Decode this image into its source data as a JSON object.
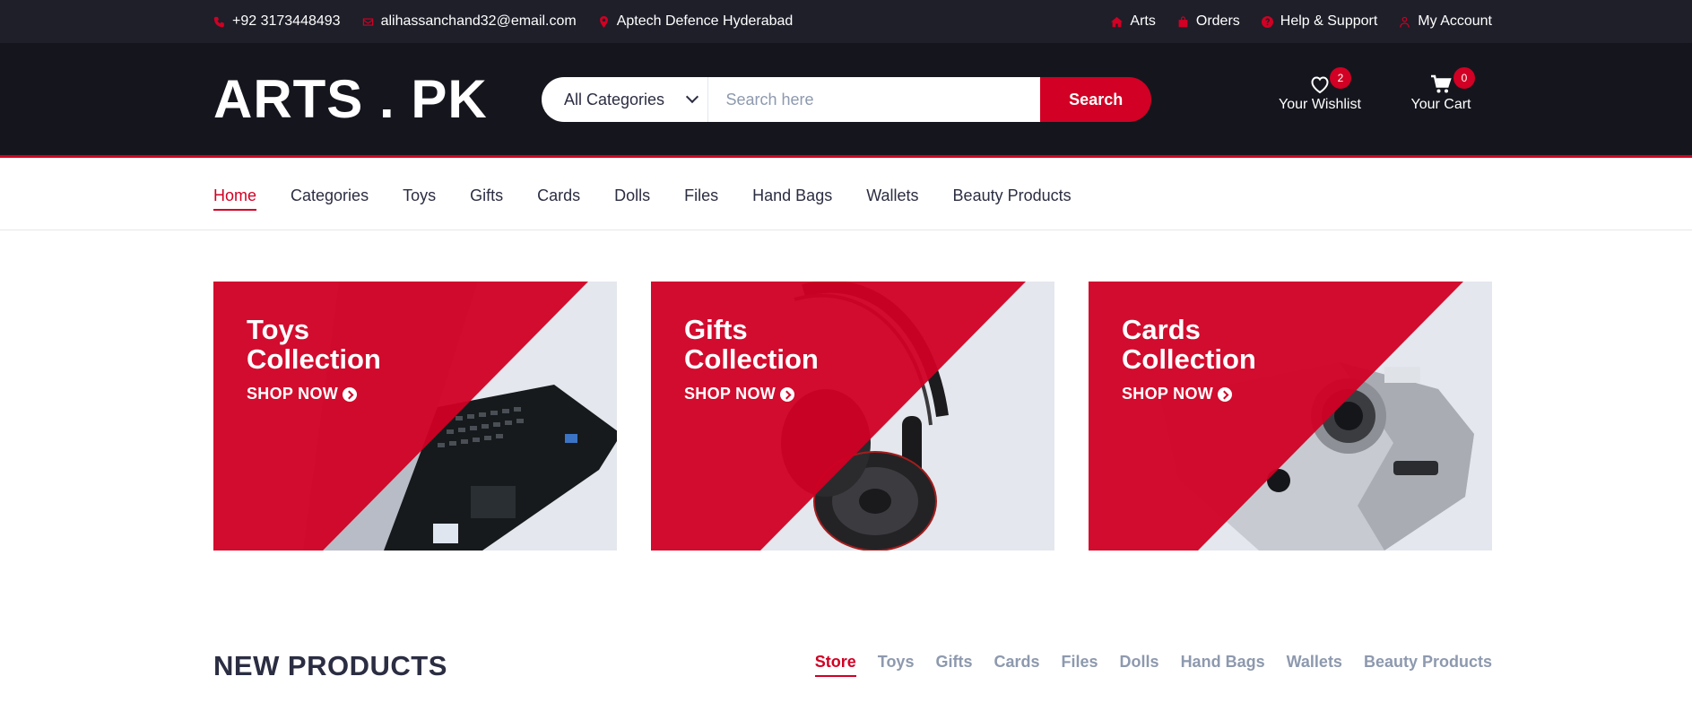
{
  "topbar": {
    "phone": "+92 3173448493",
    "email": "alihassanchand32@email.com",
    "address": "Aptech Defence Hyderabad",
    "links": [
      {
        "label": "Arts",
        "icon": "home-icon"
      },
      {
        "label": "Orders",
        "icon": "bag-icon"
      },
      {
        "label": "Help & Support",
        "icon": "question-icon"
      },
      {
        "label": "My Account",
        "icon": "user-icon"
      }
    ]
  },
  "header": {
    "logo": "ARTS . PK",
    "search": {
      "category": "All Categories",
      "placeholder": "Search here",
      "button": "Search"
    },
    "wishlist": {
      "label": "Your Wishlist",
      "count": "2"
    },
    "cart": {
      "label": "Your Cart",
      "count": "0"
    }
  },
  "nav": {
    "items": [
      "Home",
      "Categories",
      "Toys",
      "Gifts",
      "Cards",
      "Dolls",
      "Files",
      "Hand Bags",
      "Wallets",
      "Beauty Products"
    ],
    "active": "Home"
  },
  "collections": [
    {
      "title_line1": "Toys",
      "title_line2": "Collection",
      "cta": "SHOP NOW",
      "image": "laptop"
    },
    {
      "title_line1": "Gifts",
      "title_line2": "Collection",
      "cta": "SHOP NOW",
      "image": "headphones"
    },
    {
      "title_line1": "Cards",
      "title_line2": "Collection",
      "cta": "SHOP NOW",
      "image": "camera"
    }
  ],
  "new_products": {
    "title": "NEW PRODUCTS",
    "tabs": [
      "Store",
      "Toys",
      "Gifts",
      "Cards",
      "Files",
      "Dolls",
      "Hand Bags",
      "Wallets",
      "Beauty Products"
    ],
    "active": "Store"
  },
  "colors": {
    "accent": "#d10024",
    "topbar": "#1e1f29",
    "header": "#15161d",
    "muted": "#8d99ae"
  }
}
